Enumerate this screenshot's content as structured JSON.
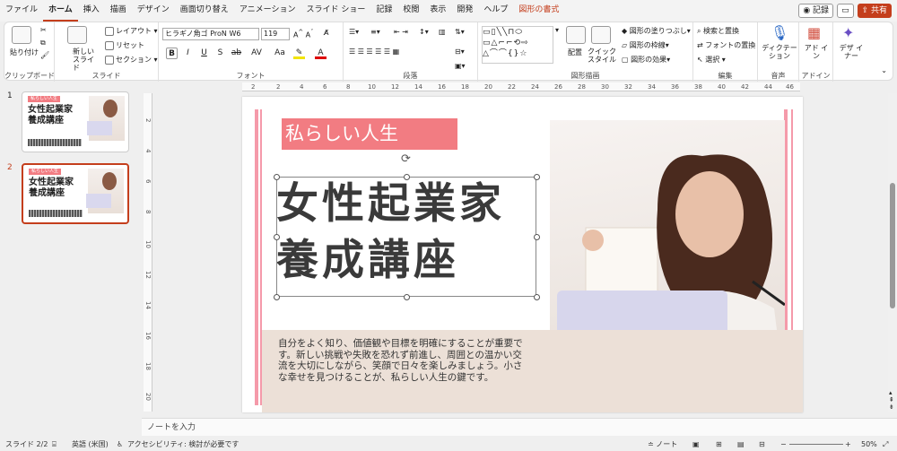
{
  "tabs": [
    "ファイル",
    "ホーム",
    "挿入",
    "描画",
    "デザイン",
    "画面切り替え",
    "アニメーション",
    "スライド ショー",
    "記録",
    "校閲",
    "表示",
    "開発",
    "ヘルプ",
    "図形の書式"
  ],
  "active_tab": "ホーム",
  "top_right": {
    "record": "記録",
    "share": "共有"
  },
  "ribbon": {
    "clipboard": {
      "paste": "貼り付け",
      "label": "クリップボード"
    },
    "slides": {
      "new_slide": "新しい スライド",
      "layout": "レイアウト",
      "reset": "リセット",
      "section": "セクション",
      "label": "スライド"
    },
    "font": {
      "name": "ヒラギノ角ゴ ProN W6",
      "size": "119",
      "label": "フォント",
      "bold": "B",
      "italic": "I",
      "underline": "U",
      "strike": "S",
      "spacing": "AV",
      "case": "Aa"
    },
    "paragraph": {
      "label": "段落"
    },
    "drawing": {
      "arrange": "配置",
      "quick_style": "クイック スタイル",
      "fill": "図形の塗りつぶし",
      "outline": "図形の枠線",
      "effects": "図形の効果",
      "label": "図形描画"
    },
    "edit": {
      "find": "検索と置換",
      "replace_font": "フォントの置換",
      "select": "選択",
      "label": "編集"
    },
    "voice": {
      "dictate": "ディクテー ション",
      "label": "音声"
    },
    "addins": {
      "addin": "アド イン",
      "label": "アドイン"
    },
    "designer": {
      "label": "デザ イナー"
    }
  },
  "thumbnails": [
    {
      "num": "1",
      "tag": "私らしい人生",
      "title1": "女性起業家",
      "title2": "養成講座"
    },
    {
      "num": "2",
      "tag": "私らしい人生",
      "title1": "女性起業家",
      "title2": "養成講座"
    }
  ],
  "ruler": {
    "h": [
      "2",
      "2",
      "4",
      "6",
      "8",
      "10",
      "12",
      "14",
      "16",
      "18",
      "20",
      "22",
      "24",
      "26",
      "28",
      "30",
      "32",
      "34",
      "36",
      "38",
      "40",
      "42",
      "44",
      "46"
    ],
    "v": [
      "2",
      "4",
      "6",
      "8",
      "10",
      "12",
      "14",
      "16",
      "18",
      "20"
    ]
  },
  "slide": {
    "tag": "私らしい人生",
    "title_line1": "女性起業家",
    "title_line2": "養成講座",
    "body": "自分をよく知り、価値観や目標を明確にすることが重要です。新しい挑戦や失敗を恐れず前進し、周囲との温かい交流を大切にしながら、笑顔で日々を楽しみましょう。小さな幸せを見つけることが、私らしい人生の鍵です。"
  },
  "notes_placeholder": "ノートを入力",
  "status": {
    "slide": "スライド 2/2",
    "lang": "英語 (米国)",
    "access": "アクセシビリティ: 検討が必要です",
    "notes": "ノート",
    "zoom": "50%"
  },
  "colors": {
    "accent": "#c43e1c",
    "pink": "#f27c82",
    "body_bg": "#ece0d7"
  }
}
